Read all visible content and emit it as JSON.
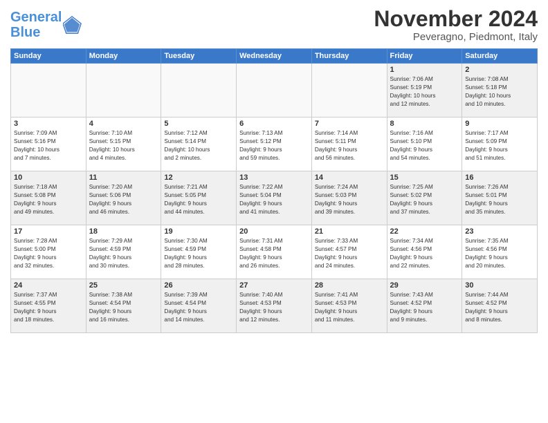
{
  "logo": {
    "line1": "General",
    "line2": "Blue"
  },
  "title": "November 2024",
  "location": "Peveragno, Piedmont, Italy",
  "weekdays": [
    "Sunday",
    "Monday",
    "Tuesday",
    "Wednesday",
    "Thursday",
    "Friday",
    "Saturday"
  ],
  "weeks": [
    [
      {
        "day": "",
        "info": ""
      },
      {
        "day": "",
        "info": ""
      },
      {
        "day": "",
        "info": ""
      },
      {
        "day": "",
        "info": ""
      },
      {
        "day": "",
        "info": ""
      },
      {
        "day": "1",
        "info": "Sunrise: 7:06 AM\nSunset: 5:19 PM\nDaylight: 10 hours\nand 12 minutes."
      },
      {
        "day": "2",
        "info": "Sunrise: 7:08 AM\nSunset: 5:18 PM\nDaylight: 10 hours\nand 10 minutes."
      }
    ],
    [
      {
        "day": "3",
        "info": "Sunrise: 7:09 AM\nSunset: 5:16 PM\nDaylight: 10 hours\nand 7 minutes."
      },
      {
        "day": "4",
        "info": "Sunrise: 7:10 AM\nSunset: 5:15 PM\nDaylight: 10 hours\nand 4 minutes."
      },
      {
        "day": "5",
        "info": "Sunrise: 7:12 AM\nSunset: 5:14 PM\nDaylight: 10 hours\nand 2 minutes."
      },
      {
        "day": "6",
        "info": "Sunrise: 7:13 AM\nSunset: 5:12 PM\nDaylight: 9 hours\nand 59 minutes."
      },
      {
        "day": "7",
        "info": "Sunrise: 7:14 AM\nSunset: 5:11 PM\nDaylight: 9 hours\nand 56 minutes."
      },
      {
        "day": "8",
        "info": "Sunrise: 7:16 AM\nSunset: 5:10 PM\nDaylight: 9 hours\nand 54 minutes."
      },
      {
        "day": "9",
        "info": "Sunrise: 7:17 AM\nSunset: 5:09 PM\nDaylight: 9 hours\nand 51 minutes."
      }
    ],
    [
      {
        "day": "10",
        "info": "Sunrise: 7:18 AM\nSunset: 5:08 PM\nDaylight: 9 hours\nand 49 minutes."
      },
      {
        "day": "11",
        "info": "Sunrise: 7:20 AM\nSunset: 5:06 PM\nDaylight: 9 hours\nand 46 minutes."
      },
      {
        "day": "12",
        "info": "Sunrise: 7:21 AM\nSunset: 5:05 PM\nDaylight: 9 hours\nand 44 minutes."
      },
      {
        "day": "13",
        "info": "Sunrise: 7:22 AM\nSunset: 5:04 PM\nDaylight: 9 hours\nand 41 minutes."
      },
      {
        "day": "14",
        "info": "Sunrise: 7:24 AM\nSunset: 5:03 PM\nDaylight: 9 hours\nand 39 minutes."
      },
      {
        "day": "15",
        "info": "Sunrise: 7:25 AM\nSunset: 5:02 PM\nDaylight: 9 hours\nand 37 minutes."
      },
      {
        "day": "16",
        "info": "Sunrise: 7:26 AM\nSunset: 5:01 PM\nDaylight: 9 hours\nand 35 minutes."
      }
    ],
    [
      {
        "day": "17",
        "info": "Sunrise: 7:28 AM\nSunset: 5:00 PM\nDaylight: 9 hours\nand 32 minutes."
      },
      {
        "day": "18",
        "info": "Sunrise: 7:29 AM\nSunset: 4:59 PM\nDaylight: 9 hours\nand 30 minutes."
      },
      {
        "day": "19",
        "info": "Sunrise: 7:30 AM\nSunset: 4:59 PM\nDaylight: 9 hours\nand 28 minutes."
      },
      {
        "day": "20",
        "info": "Sunrise: 7:31 AM\nSunset: 4:58 PM\nDaylight: 9 hours\nand 26 minutes."
      },
      {
        "day": "21",
        "info": "Sunrise: 7:33 AM\nSunset: 4:57 PM\nDaylight: 9 hours\nand 24 minutes."
      },
      {
        "day": "22",
        "info": "Sunrise: 7:34 AM\nSunset: 4:56 PM\nDaylight: 9 hours\nand 22 minutes."
      },
      {
        "day": "23",
        "info": "Sunrise: 7:35 AM\nSunset: 4:56 PM\nDaylight: 9 hours\nand 20 minutes."
      }
    ],
    [
      {
        "day": "24",
        "info": "Sunrise: 7:37 AM\nSunset: 4:55 PM\nDaylight: 9 hours\nand 18 minutes."
      },
      {
        "day": "25",
        "info": "Sunrise: 7:38 AM\nSunset: 4:54 PM\nDaylight: 9 hours\nand 16 minutes."
      },
      {
        "day": "26",
        "info": "Sunrise: 7:39 AM\nSunset: 4:54 PM\nDaylight: 9 hours\nand 14 minutes."
      },
      {
        "day": "27",
        "info": "Sunrise: 7:40 AM\nSunset: 4:53 PM\nDaylight: 9 hours\nand 12 minutes."
      },
      {
        "day": "28",
        "info": "Sunrise: 7:41 AM\nSunset: 4:53 PM\nDaylight: 9 hours\nand 11 minutes."
      },
      {
        "day": "29",
        "info": "Sunrise: 7:43 AM\nSunset: 4:52 PM\nDaylight: 9 hours\nand 9 minutes."
      },
      {
        "day": "30",
        "info": "Sunrise: 7:44 AM\nSunset: 4:52 PM\nDaylight: 9 hours\nand 8 minutes."
      }
    ]
  ]
}
